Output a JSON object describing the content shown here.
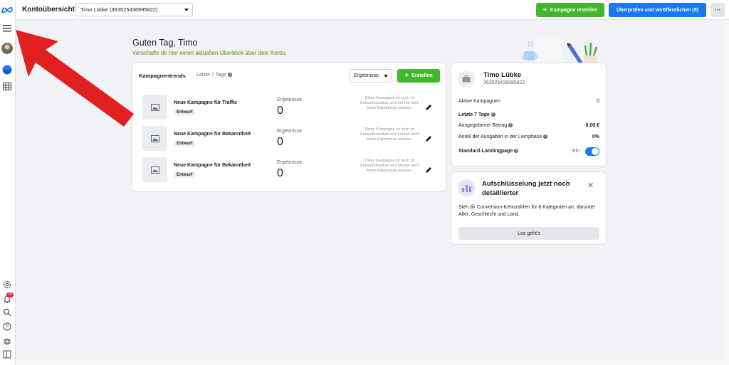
{
  "topbar": {
    "title": "Kontoübersicht",
    "account_selector": "Timo Lübke (363525436995822)",
    "create_campaign": "Kampagne erstellen",
    "review_publish": "Überprüfen und veröffentlichen (9)",
    "more": "···"
  },
  "rail": {
    "notification_count": "18"
  },
  "greeting": {
    "title": "Guten Tag, Timo",
    "subtitle": "Verschaffe dir hier einen aktuellen Überblick über dein Konto."
  },
  "trends": {
    "title": "Kampagnentrends",
    "range": "Letzte 7 Tage",
    "metric_dropdown": "Ergebnisse",
    "create_button": "Erstellen",
    "rows": [
      {
        "name": "Neue Kampagne für Traffic",
        "status": "Entwurf",
        "result_label": "Ergebnisse",
        "result_value": "0",
        "note": "Diese Kampagne ist noch im Entwurfsstadium und konnte noch keine Ergebnisse erzielen."
      },
      {
        "name": "Neue Kampagne für Bekanntheit",
        "status": "Entwurf",
        "result_label": "Ergebnisse",
        "result_value": "0",
        "note": "Diese Kampagne ist noch im Entwurfsstadium und konnte noch keine Ergebnisse erzielen."
      },
      {
        "name": "Neue Kampagne für Bekanntheit",
        "status": "Entwurf",
        "result_label": "Ergebnisse",
        "result_value": "0",
        "note": "Diese Kampagne ist noch im Entwurfsstadium und konnte noch keine Ergebnisse erzielen."
      }
    ]
  },
  "profile": {
    "name": "Timo Lübke",
    "id": "363525436995822",
    "active_label": "Aktive Kampagnen",
    "active_value": "0",
    "period_label": "Letzte 7 Tage",
    "spent_label": "Ausgegebener Betrag",
    "spent_value": "0,00 €",
    "learning_label": "Anteil der Ausgaben in der Lernphase",
    "learning_value": "0%",
    "landing_label": "Standard-Landingpage",
    "landing_state": "Ein"
  },
  "promo": {
    "title": "Aufschlüsselung jetzt noch detaillierter",
    "text": "Sieh dir Conversion-Kennzahlen für 8 Kategorien an, darunter Alter, Geschlecht und Land.",
    "button": "Los geht's",
    "close": "✕"
  },
  "colors": {
    "green": "#42b72a",
    "blue": "#1877f2",
    "arrow_red": "#e02020"
  }
}
